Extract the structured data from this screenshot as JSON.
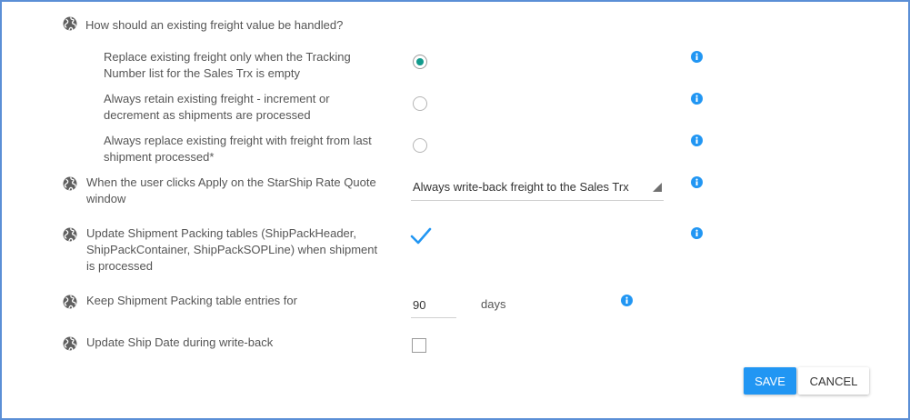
{
  "colors": {
    "frame_border": "#5b8fd6",
    "accent_blue": "#2196f3",
    "radio_selected": "#119a8c",
    "text": "#555555"
  },
  "icons": {
    "globe": "globe-icon",
    "info": "info-icon",
    "checkmark": "checkmark-icon",
    "dropdown": "dropdown-arrow-icon"
  },
  "freight_question": {
    "label": "How should an existing freight value be handled?",
    "options": [
      {
        "line1": "Replace existing freight only when the Tracking",
        "line2": "Number list for the Sales Trx is empty",
        "selected": true
      },
      {
        "line1": "Always retain existing freight - increment or",
        "line2": "decrement as shipments are processed",
        "selected": false
      },
      {
        "line1": "Always replace existing freight with freight from last",
        "line2": "shipment processed*",
        "selected": false
      }
    ]
  },
  "apply_setting": {
    "line1": "When the user clicks Apply on the StarShip Rate Quote",
    "line2": "window",
    "selected_value": "Always write-back freight to the Sales Trx"
  },
  "packing_tables_setting": {
    "line1": "Update Shipment Packing tables (ShipPackHeader,",
    "line2": "ShipPackContainer, ShipPackSOPLine) when shipment",
    "line3": "is processed",
    "checked": true
  },
  "keep_entries_setting": {
    "label": "Keep Shipment Packing table entries for",
    "value": "90",
    "unit": "days"
  },
  "ship_date_setting": {
    "label": "Update Ship Date during write-back",
    "checked": false
  },
  "actions": {
    "save_label": "SAVE",
    "cancel_label": "CANCEL"
  }
}
